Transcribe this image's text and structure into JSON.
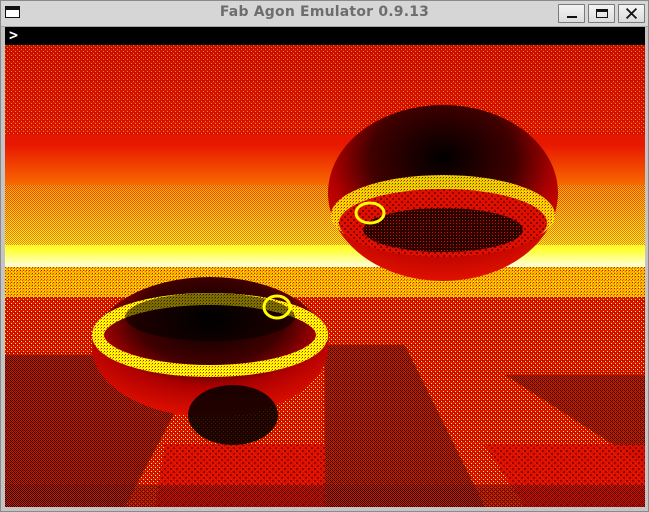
{
  "window": {
    "title": "Fab Agon Emulator 0.9.13"
  },
  "controls": {
    "minimize_icon": "minimize-icon",
    "maximize_icon": "maximize-icon",
    "close_icon": "close-icon"
  },
  "console": {
    "prompt": ">"
  },
  "scene": {
    "description_icon": "raytraced-spheres",
    "colors": {
      "red": "#e01000",
      "dark_red": "#8a0000",
      "yellow": "#ffff00",
      "black": "#000000",
      "white": "#ffffff"
    }
  }
}
